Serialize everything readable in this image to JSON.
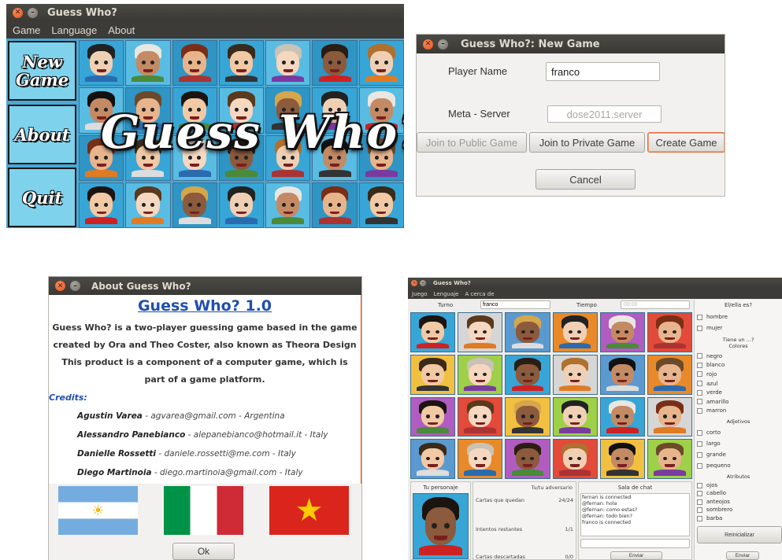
{
  "w1": {
    "title": "Guess Who?",
    "menu": [
      "Game",
      "Language",
      "About"
    ],
    "side": [
      "New Game",
      "About",
      "Quit"
    ],
    "logo": "Guess Who?"
  },
  "w2": {
    "title": "Guess Who?: New Game",
    "player_label": "Player Name",
    "player_value": "franco",
    "meta_label": "Meta - Server",
    "meta_value": "dose2011.server",
    "join_public": "Join to Public Game",
    "join_private": "Join to Private Game",
    "create": "Create Game",
    "cancel": "Cancel"
  },
  "w3": {
    "title": "About Guess Who?",
    "heading": "Guess Who? 1.0",
    "desc1": "Guess Who? is a two-player guessing game based in the game",
    "desc2": "created by Ora and Theo Coster, also known as Theora Design",
    "desc3": "This product is a component of a computer game, which is",
    "desc4": "part of a game platform.",
    "credits_label": "Credits:",
    "credits": [
      {
        "name": "Agustin Varea",
        "rest": " - agvarea@gmail.com - Argentina"
      },
      {
        "name": "Alessandro Panebianco",
        "rest": " - alepanebianco@hotmail.it - Italy"
      },
      {
        "name": "Danielle Rossetti",
        "rest": " - daniele.rossetti@me.com - Italy"
      },
      {
        "name": "Diego Martinoia",
        "rest": " - diego.martinoia@gmail.com - Italy"
      }
    ],
    "ok": "Ok"
  },
  "w4": {
    "title": "Guess Who?",
    "menu": [
      "Juego",
      "Lenguaje",
      "A cerca de"
    ],
    "turn_label": "Turno",
    "turn_value": "franco",
    "time_label": "Tiempo",
    "time_value": "00:00",
    "side": {
      "q1": "El/ella es?",
      "gender": [
        "hombre",
        "mujer"
      ],
      "q2": "Tiene un ...?",
      "colors_label": "Colores",
      "colors": [
        "negro",
        "blanco",
        "rojo",
        "azul",
        "verde",
        "amarillo",
        "marron"
      ],
      "adj_label": "Adjetivos",
      "adj": [
        "corto",
        "largo",
        "grande",
        "pequeno"
      ],
      "attr_label": "Atributos",
      "attr": [
        "ojos",
        "cabello",
        "anteojos",
        "sombrero",
        "barba"
      ],
      "reset": "Reinicializar",
      "send": "Enviar"
    },
    "personaje_label": "Tu personaje",
    "adversario_label": "Tu/tu adversario",
    "stats": [
      {
        "label": "Cartas que quedan",
        "value": "24/24"
      },
      {
        "label": "Intentos restantes",
        "value": "1/1"
      },
      {
        "label": "Cartas descartadas",
        "value": "0/0"
      }
    ],
    "chat_label": "Sala de chat",
    "chat": [
      "fernan is connected",
      "@fernan: hola",
      "@fernan: como estas?",
      "@fernan: todo bien?",
      "franco is connected"
    ],
    "chat_send": "Enviar"
  },
  "colors": {
    "accent": "#e2521d",
    "titlebar": "#3c3b37",
    "tile_blue": "#37a6d6"
  }
}
